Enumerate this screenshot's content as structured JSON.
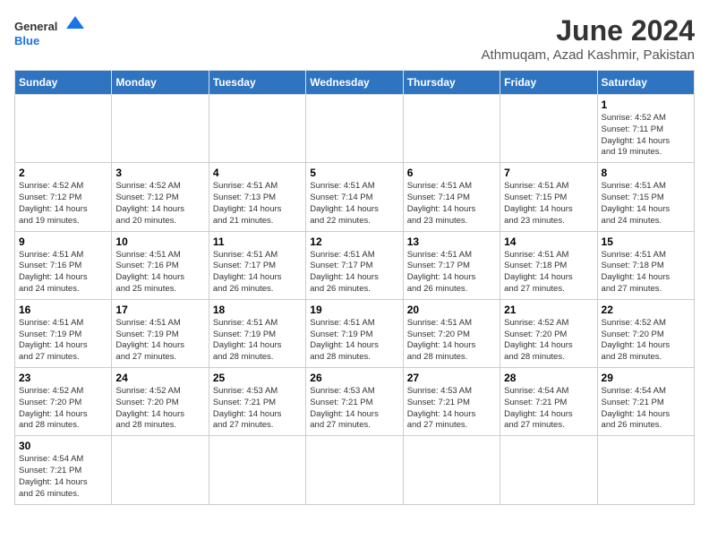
{
  "header": {
    "logo_general": "General",
    "logo_blue": "Blue",
    "month_title": "June 2024",
    "subtitle": "Athmuqam, Azad Kashmir, Pakistan"
  },
  "weekdays": [
    "Sunday",
    "Monday",
    "Tuesday",
    "Wednesday",
    "Thursday",
    "Friday",
    "Saturday"
  ],
  "weeks": [
    [
      {
        "day": null
      },
      {
        "day": null
      },
      {
        "day": null
      },
      {
        "day": null
      },
      {
        "day": null
      },
      {
        "day": null
      },
      {
        "day": 1,
        "sunrise": "4:52 AM",
        "sunset": "7:11 PM",
        "daylight": "14 hours and 19 minutes."
      }
    ],
    [
      {
        "day": 2,
        "sunrise": "4:52 AM",
        "sunset": "7:12 PM",
        "daylight": "14 hours and 19 minutes."
      },
      {
        "day": 3,
        "sunrise": "4:52 AM",
        "sunset": "7:12 PM",
        "daylight": "14 hours and 20 minutes."
      },
      {
        "day": 4,
        "sunrise": "4:51 AM",
        "sunset": "7:13 PM",
        "daylight": "14 hours and 21 minutes."
      },
      {
        "day": 5,
        "sunrise": "4:51 AM",
        "sunset": "7:14 PM",
        "daylight": "14 hours and 22 minutes."
      },
      {
        "day": 6,
        "sunrise": "4:51 AM",
        "sunset": "7:14 PM",
        "daylight": "14 hours and 23 minutes."
      },
      {
        "day": 7,
        "sunrise": "4:51 AM",
        "sunset": "7:15 PM",
        "daylight": "14 hours and 23 minutes."
      },
      {
        "day": 8,
        "sunrise": "4:51 AM",
        "sunset": "7:15 PM",
        "daylight": "14 hours and 24 minutes."
      }
    ],
    [
      {
        "day": 9,
        "sunrise": "4:51 AM",
        "sunset": "7:16 PM",
        "daylight": "14 hours and 24 minutes."
      },
      {
        "day": 10,
        "sunrise": "4:51 AM",
        "sunset": "7:16 PM",
        "daylight": "14 hours and 25 minutes."
      },
      {
        "day": 11,
        "sunrise": "4:51 AM",
        "sunset": "7:17 PM",
        "daylight": "14 hours and 26 minutes."
      },
      {
        "day": 12,
        "sunrise": "4:51 AM",
        "sunset": "7:17 PM",
        "daylight": "14 hours and 26 minutes."
      },
      {
        "day": 13,
        "sunrise": "4:51 AM",
        "sunset": "7:17 PM",
        "daylight": "14 hours and 26 minutes."
      },
      {
        "day": 14,
        "sunrise": "4:51 AM",
        "sunset": "7:18 PM",
        "daylight": "14 hours and 27 minutes."
      },
      {
        "day": 15,
        "sunrise": "4:51 AM",
        "sunset": "7:18 PM",
        "daylight": "14 hours and 27 minutes."
      }
    ],
    [
      {
        "day": 16,
        "sunrise": "4:51 AM",
        "sunset": "7:19 PM",
        "daylight": "14 hours and 27 minutes."
      },
      {
        "day": 17,
        "sunrise": "4:51 AM",
        "sunset": "7:19 PM",
        "daylight": "14 hours and 27 minutes."
      },
      {
        "day": 18,
        "sunrise": "4:51 AM",
        "sunset": "7:19 PM",
        "daylight": "14 hours and 28 minutes."
      },
      {
        "day": 19,
        "sunrise": "4:51 AM",
        "sunset": "7:19 PM",
        "daylight": "14 hours and 28 minutes."
      },
      {
        "day": 20,
        "sunrise": "4:51 AM",
        "sunset": "7:20 PM",
        "daylight": "14 hours and 28 minutes."
      },
      {
        "day": 21,
        "sunrise": "4:52 AM",
        "sunset": "7:20 PM",
        "daylight": "14 hours and 28 minutes."
      },
      {
        "day": 22,
        "sunrise": "4:52 AM",
        "sunset": "7:20 PM",
        "daylight": "14 hours and 28 minutes."
      }
    ],
    [
      {
        "day": 23,
        "sunrise": "4:52 AM",
        "sunset": "7:20 PM",
        "daylight": "14 hours and 28 minutes."
      },
      {
        "day": 24,
        "sunrise": "4:52 AM",
        "sunset": "7:20 PM",
        "daylight": "14 hours and 28 minutes."
      },
      {
        "day": 25,
        "sunrise": "4:53 AM",
        "sunset": "7:21 PM",
        "daylight": "14 hours and 27 minutes."
      },
      {
        "day": 26,
        "sunrise": "4:53 AM",
        "sunset": "7:21 PM",
        "daylight": "14 hours and 27 minutes."
      },
      {
        "day": 27,
        "sunrise": "4:53 AM",
        "sunset": "7:21 PM",
        "daylight": "14 hours and 27 minutes."
      },
      {
        "day": 28,
        "sunrise": "4:54 AM",
        "sunset": "7:21 PM",
        "daylight": "14 hours and 27 minutes."
      },
      {
        "day": 29,
        "sunrise": "4:54 AM",
        "sunset": "7:21 PM",
        "daylight": "14 hours and 26 minutes."
      }
    ],
    [
      {
        "day": 30,
        "sunrise": "4:54 AM",
        "sunset": "7:21 PM",
        "daylight": "14 hours and 26 minutes."
      },
      {
        "day": null
      },
      {
        "day": null
      },
      {
        "day": null
      },
      {
        "day": null
      },
      {
        "day": null
      },
      {
        "day": null
      }
    ]
  ],
  "labels": {
    "sunrise": "Sunrise:",
    "sunset": "Sunset:",
    "daylight": "Daylight:"
  }
}
